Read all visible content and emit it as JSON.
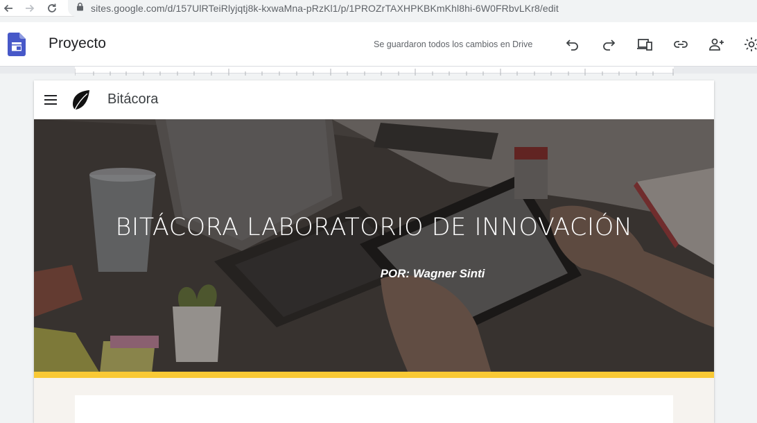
{
  "browser": {
    "url": "sites.google.com/d/157UlRTeiRlyjqtj8k-kxwaMna-pRzKl1/p/1PROZrTAXHPKBKmKhl8hi-6W0FRbvLKr8/edit",
    "icons": [
      "back-arrow-icon",
      "forward-arrow-icon",
      "reload-icon",
      "lock-icon"
    ]
  },
  "editor": {
    "title": "Proyecto",
    "save_status": "Se guardaron todos los cambios en Drive",
    "toolbar_icons": [
      "undo-icon",
      "redo-icon",
      "preview-devices-icon",
      "link-icon",
      "add-person-icon",
      "gear-icon"
    ]
  },
  "site": {
    "name": "Bitácora",
    "hero_title": "BITÁCORA LABORATORIO DE INNOVACIÓN",
    "hero_subtitle": "POR: Wagner Sinti"
  },
  "colors": {
    "sites_brand": "#4758c8",
    "accent_bar": "#f9c935",
    "content_bg": "#f6f3ef"
  }
}
